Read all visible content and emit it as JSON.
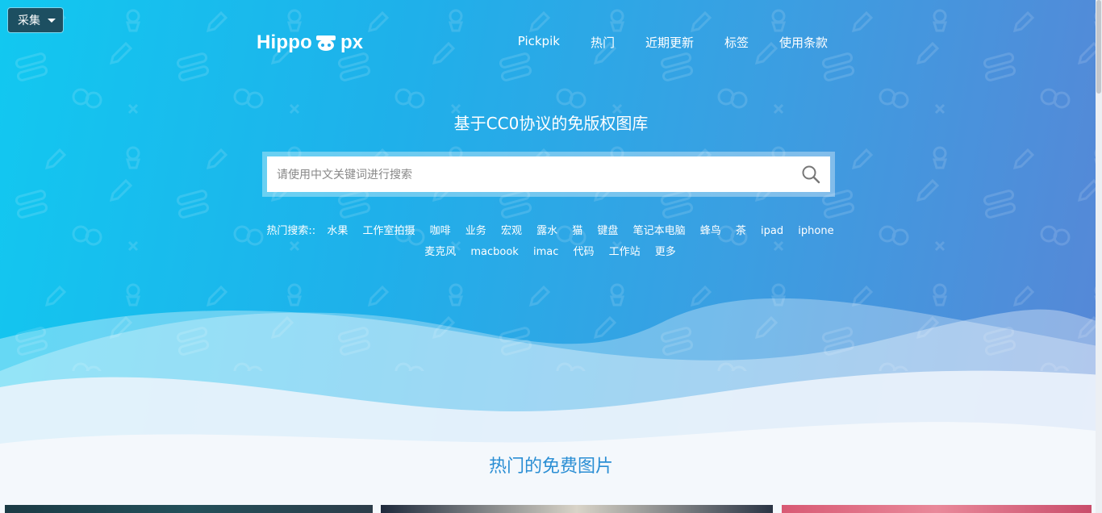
{
  "collect_button": {
    "label": "采集"
  },
  "logo": {
    "left_text": "Hippo",
    "right_text": "px"
  },
  "nav": {
    "items": [
      {
        "label": "Pickpik"
      },
      {
        "label": "热门"
      },
      {
        "label": "近期更新"
      },
      {
        "label": "标签"
      },
      {
        "label": "使用条款"
      }
    ]
  },
  "hero": {
    "tagline": "基于CC0协议的免版权图库"
  },
  "search": {
    "placeholder": "请使用中文关键词进行搜索",
    "value": ""
  },
  "hot_search": {
    "label": "热门搜索::",
    "items": [
      "水果",
      "工作室拍摄",
      "咖啡",
      "业务",
      "宏观",
      "露水",
      "猫",
      "键盘",
      "笔记本电脑",
      "蜂鸟",
      "茶",
      "ipad",
      "iphone",
      "麦克风",
      "macbook",
      "imac",
      "代码",
      "工作站",
      "更多"
    ]
  },
  "section": {
    "title": "热门的免费图片"
  },
  "colors": {
    "gradient_start": "#12c8f0",
    "gradient_end": "#5886d6",
    "section_title": "#2a8ed4",
    "collect_button_bg": "#1d4f61"
  },
  "icons": {
    "search": "search-icon",
    "caret": "caret-down-icon",
    "logo_mark": "hippo-logo-icon"
  }
}
